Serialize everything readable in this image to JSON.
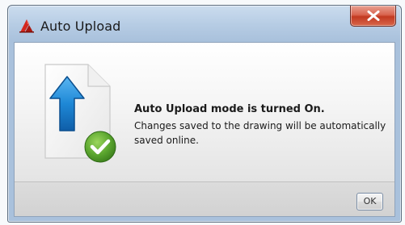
{
  "window": {
    "title": "Auto Upload",
    "close_icon": "close-x-icon",
    "app_icon": "autocad-logo-icon"
  },
  "message": {
    "icon": "upload-document-check-icon",
    "heading": "Auto Upload mode is turned On.",
    "body": "Changes saved to the drawing will be automatically saved online."
  },
  "footer": {
    "ok_label": "OK"
  },
  "colors": {
    "title_bar": "#b6cce4",
    "close_button": "#c23a22",
    "upload_arrow": "#1e88d6",
    "check_badge": "#5aa52e"
  }
}
